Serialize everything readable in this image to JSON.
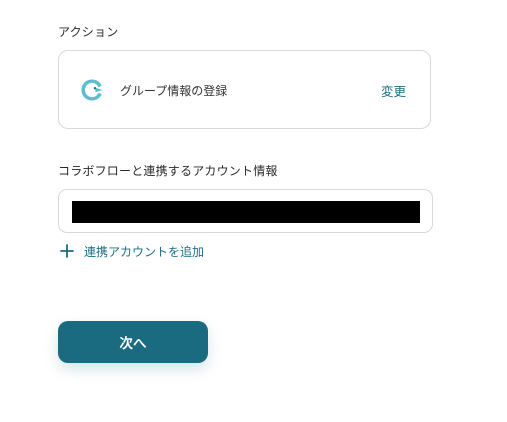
{
  "action_section": {
    "label": "アクション",
    "app_icon": "collabflow-logo-icon",
    "action_name": "グループ情報の登録",
    "change_label": "変更"
  },
  "account_section": {
    "label": "コラボフローと連携するアカウント情報",
    "account_value": "",
    "add_account_label": "連携アカウントを追加",
    "add_icon": "plus-icon"
  },
  "next_button": {
    "label": "次へ"
  },
  "colors": {
    "accent": "#1d6c84",
    "button": "#1a6a80",
    "icon": "#5bbfd2",
    "border": "#d6d9dd"
  }
}
